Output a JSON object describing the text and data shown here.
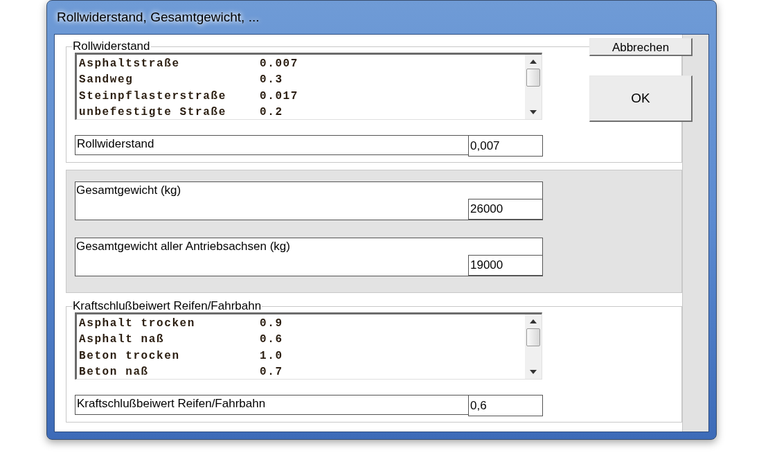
{
  "window": {
    "title": "Rollwiderstand, Gesamtgewicht, ..."
  },
  "rolling_resistance": {
    "title": "Rollwiderstand",
    "list": [
      {
        "name": "Asphaltstraße",
        "value": "0.007"
      },
      {
        "name": "Sandweg",
        "value": "0.3"
      },
      {
        "name": "Steinpflasterstraße",
        "value": "0.017"
      },
      {
        "name": "unbefestigte Straße",
        "value": "0.2"
      }
    ],
    "field": {
      "label": "Rollwiderstand",
      "value": "0,007"
    }
  },
  "weights": [
    {
      "label": "Gesamtgewicht  (kg)",
      "value": "26000"
    },
    {
      "label": "Gesamtgewicht aller Antriebsachsen  (kg)",
      "value": "19000"
    }
  ],
  "traction": {
    "title": "Kraftschlußbeiwert Reifen/Fahrbahn",
    "list": [
      {
        "name": "Asphalt trocken",
        "value": "0.9"
      },
      {
        "name": "Asphalt naß",
        "value": "0.6"
      },
      {
        "name": "Beton trocken",
        "value": "1.0"
      },
      {
        "name": "Beton naß",
        "value": "0.7"
      }
    ],
    "field": {
      "label": "Kraftschlußbeiwert Reifen/Fahrbahn",
      "value": "0,6"
    }
  },
  "buttons": [
    {
      "label": "Abbrechen"
    },
    {
      "label": "OK"
    }
  ]
}
